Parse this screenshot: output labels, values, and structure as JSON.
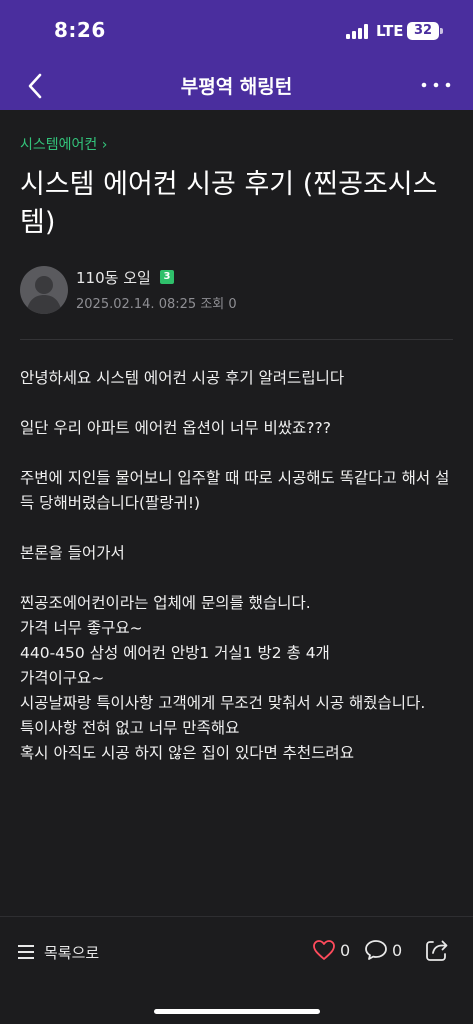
{
  "status_bar": {
    "time": "8:26",
    "network": "LTE",
    "battery": "32"
  },
  "nav": {
    "title": "부평역 해링턴",
    "back_icon": "chevron-left-icon",
    "more_icon": "ellipsis-icon"
  },
  "post": {
    "category": "시스템에어컨 ›",
    "title": "시스템 에어컨 시공 후기 (찐공조시스템)",
    "author": "110동 오일",
    "author_level": "3",
    "date": "2025.02.14. 08:25",
    "views": "조회 0",
    "paragraphs": [
      [
        "안녕하세요 시스템 에어컨 시공 후기 알려드립니다"
      ],
      [
        "일단 우리 아파트 에어컨 옵션이 너무 비쌌죠???"
      ],
      [
        "주변에 지인들 물어보니 입주할 때 따로 시공해도 똑같다고 해서 설득 당해버렸습니다(팔랑귀!)"
      ],
      [
        "본론을 들어가서"
      ],
      [
        "찐공조에어컨이라는 업체에 문의를 했습니다.",
        "가격 너무 좋구요~",
        "440-450 삼성 에어컨 안방1 거실1 방2 총 4개",
        "가격이구요~",
        "시공날짜랑 특이사항 고객에게 무조건 맞춰서 시공 해줬습니다.",
        "특이사항 전혀 없고 너무 만족해요",
        "혹시 아직도 시공 하지 않은 집이 있다면 추천드려요"
      ]
    ]
  },
  "bottom_bar": {
    "list_label": "목록으로",
    "like_count": "0",
    "comment_count": "0"
  },
  "colors": {
    "header": "#4a2e9e",
    "background": "#1c1c1e",
    "category": "#33c47b",
    "like": "#ff4b5c"
  }
}
